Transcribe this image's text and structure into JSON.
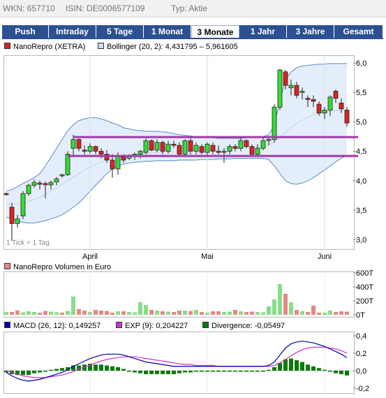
{
  "header": {
    "wkn": "WKN: 657710",
    "isin": "ISIN: DE0006577109",
    "typ": "Typ: Aktie"
  },
  "tabs": [
    {
      "label": "Push"
    },
    {
      "label": "Intraday"
    },
    {
      "label": "5 Tage"
    },
    {
      "label": "1 Monat"
    },
    {
      "label": "3 Monate",
      "active": true
    },
    {
      "label": "1 Jahr"
    },
    {
      "label": "3 Jahre"
    },
    {
      "label": "Gesamt"
    }
  ],
  "colors": {
    "up": "#33dd33",
    "down": "#dd2222",
    "band": "#e4eefa",
    "bandLine": "#5a89c8",
    "purple": "#a03aa8",
    "tab": "#2b5193",
    "macd": "#0000aa",
    "exp": "#cc33cc",
    "div": "#0a7a0a",
    "volDown": "#e48888",
    "volUp": "#88dd88"
  },
  "legends": {
    "price": "NanoRepro (XETRA)",
    "bollinger": "Bollinger (20, 2): 4,431795 – 5,961605",
    "volume": "NanoRepro Volumen in Euro",
    "macd": "MACD (26, 12): 0,149257",
    "exp": "EXP (9): 0,204227",
    "divergence": "Divergence: -0,05497"
  },
  "note": "1 Tick = 1 Tag",
  "chart_data": [
    {
      "type": "candlestick",
      "title": "NanoRepro (XETRA)",
      "x_labels": [
        "April",
        "Mai",
        "Juni"
      ],
      "x_label_index": [
        15,
        36,
        57
      ],
      "yticks": [
        3.0,
        3.5,
        4.0,
        4.5,
        5.0,
        5.5,
        6.0
      ],
      "ytick_labels": [
        "3,0",
        "3,5",
        "4,0",
        "4,5",
        "5,0",
        "5,5",
        "6,0"
      ],
      "ylim": [
        2.85,
        6.12
      ],
      "ohlc": [
        [
          3.78,
          3.8,
          3.75,
          3.77
        ],
        [
          3.55,
          3.62,
          2.98,
          3.27
        ],
        [
          3.27,
          3.42,
          3.2,
          3.35
        ],
        [
          3.4,
          3.82,
          3.35,
          3.78
        ],
        [
          3.78,
          3.95,
          3.74,
          3.92
        ],
        [
          3.92,
          4.02,
          3.88,
          3.97
        ],
        [
          3.96,
          4.0,
          3.85,
          3.94
        ],
        [
          3.95,
          3.99,
          3.7,
          3.93
        ],
        [
          3.93,
          4.0,
          3.85,
          3.97
        ],
        [
          3.98,
          4.06,
          3.92,
          4.03
        ],
        [
          4.1,
          4.12,
          4.05,
          4.1
        ],
        [
          4.1,
          4.5,
          4.08,
          4.45
        ],
        [
          4.55,
          4.78,
          4.4,
          4.7
        ],
        [
          4.7,
          4.72,
          4.5,
          4.55
        ],
        [
          4.52,
          4.6,
          4.45,
          4.5
        ],
        [
          4.5,
          4.63,
          4.46,
          4.58
        ],
        [
          4.58,
          4.6,
          4.45,
          4.5
        ],
        [
          4.5,
          4.55,
          4.38,
          4.45
        ],
        [
          4.45,
          4.52,
          4.3,
          4.35
        ],
        [
          4.35,
          4.45,
          4.05,
          4.2
        ],
        [
          4.2,
          4.48,
          4.1,
          4.42
        ],
        [
          4.4,
          4.45,
          4.3,
          4.35
        ],
        [
          4.38,
          4.45,
          4.35,
          4.42
        ],
        [
          4.42,
          4.48,
          4.35,
          4.45
        ],
        [
          4.45,
          4.52,
          4.38,
          4.5
        ],
        [
          4.48,
          4.72,
          4.45,
          4.68
        ],
        [
          4.68,
          4.7,
          4.5,
          4.52
        ],
        [
          4.52,
          4.7,
          4.48,
          4.65
        ],
        [
          4.65,
          4.68,
          4.45,
          4.5
        ],
        [
          4.5,
          4.68,
          4.46,
          4.62
        ],
        [
          4.62,
          4.68,
          4.55,
          4.6
        ],
        [
          4.6,
          4.65,
          4.4,
          4.45
        ],
        [
          4.45,
          4.7,
          4.4,
          4.68
        ],
        [
          4.68,
          4.72,
          4.45,
          4.5
        ],
        [
          4.5,
          4.65,
          4.45,
          4.6
        ],
        [
          4.58,
          4.62,
          4.45,
          4.48
        ],
        [
          4.48,
          4.65,
          4.4,
          4.62
        ],
        [
          4.6,
          4.65,
          4.45,
          4.5
        ],
        [
          4.5,
          4.6,
          4.45,
          4.48
        ],
        [
          4.48,
          4.55,
          4.3,
          4.5
        ],
        [
          4.5,
          4.62,
          4.45,
          4.58
        ],
        [
          4.58,
          4.62,
          4.5,
          4.55
        ],
        [
          4.55,
          4.72,
          4.5,
          4.68
        ],
        [
          4.68,
          4.7,
          4.55,
          4.58
        ],
        [
          4.58,
          4.62,
          4.4,
          4.45
        ],
        [
          4.45,
          4.62,
          4.4,
          4.55
        ],
        [
          4.55,
          4.75,
          4.52,
          4.68
        ],
        [
          4.7,
          4.75,
          4.6,
          4.7
        ],
        [
          4.7,
          5.3,
          4.65,
          5.25
        ],
        [
          5.25,
          5.9,
          5.2,
          5.88
        ],
        [
          5.85,
          5.88,
          5.55,
          5.62
        ],
        [
          5.58,
          5.72,
          5.45,
          5.62
        ],
        [
          5.62,
          5.68,
          5.4,
          5.45
        ],
        [
          5.5,
          5.58,
          5.38,
          5.52
        ],
        [
          5.4,
          5.45,
          5.25,
          5.38
        ],
        [
          5.38,
          5.45,
          5.25,
          5.35
        ],
        [
          5.3,
          5.35,
          5.1,
          5.15
        ],
        [
          5.15,
          5.25,
          5.05,
          5.2
        ],
        [
          5.2,
          5.45,
          5.1,
          5.42
        ],
        [
          5.52,
          5.55,
          5.32,
          5.4
        ],
        [
          5.32,
          5.4,
          5.15,
          5.22
        ],
        [
          5.2,
          5.25,
          4.92,
          4.98
        ]
      ],
      "bollinger": {
        "upper": [
          3.82,
          3.85,
          3.9,
          3.95,
          4.0,
          4.05,
          4.12,
          4.25,
          4.4,
          4.55,
          4.7,
          4.85,
          4.95,
          5.02,
          5.05,
          5.07,
          5.07,
          5.05,
          5.02,
          4.98,
          4.95,
          4.9,
          4.88,
          4.86,
          4.85,
          4.84,
          4.84,
          4.84,
          4.83,
          4.82,
          4.8,
          4.78,
          4.77,
          4.76,
          4.75,
          4.74,
          4.74,
          4.73,
          4.72,
          4.72,
          4.72,
          4.72,
          4.72,
          4.73,
          4.73,
          4.74,
          4.75,
          4.78,
          4.95,
          5.35,
          5.72,
          5.85,
          5.92,
          5.95,
          5.96,
          5.97,
          5.98,
          5.98,
          5.99,
          5.99,
          5.99,
          5.99
        ],
        "middle": [
          3.6,
          3.6,
          3.61,
          3.62,
          3.65,
          3.68,
          3.72,
          3.77,
          3.82,
          3.88,
          3.94,
          4.0,
          4.06,
          4.12,
          4.18,
          4.23,
          4.28,
          4.32,
          4.35,
          4.38,
          4.4,
          4.42,
          4.43,
          4.44,
          4.45,
          4.46,
          4.47,
          4.48,
          4.48,
          4.49,
          4.49,
          4.5,
          4.5,
          4.5,
          4.51,
          4.51,
          4.52,
          4.52,
          4.53,
          4.53,
          4.54,
          4.54,
          4.55,
          4.55,
          4.56,
          4.57,
          4.58,
          4.6,
          4.66,
          4.74,
          4.82,
          4.9,
          4.97,
          5.03,
          5.08,
          5.12,
          5.15,
          5.17,
          5.18,
          5.19,
          5.19,
          5.2
        ],
        "lower": [
          3.38,
          3.35,
          3.32,
          3.29,
          3.28,
          3.28,
          3.3,
          3.32,
          3.35,
          3.38,
          3.42,
          3.48,
          3.55,
          3.62,
          3.72,
          3.82,
          3.92,
          4.02,
          4.12,
          4.2,
          4.25,
          4.28,
          4.3,
          4.31,
          4.32,
          4.33,
          4.33,
          4.34,
          4.34,
          4.34,
          4.34,
          4.35,
          4.35,
          4.35,
          4.35,
          4.36,
          4.36,
          4.36,
          4.37,
          4.37,
          4.37,
          4.38,
          4.38,
          4.38,
          4.38,
          4.38,
          4.38,
          4.36,
          4.25,
          4.12,
          4.0,
          3.95,
          3.94,
          3.96,
          4.0,
          4.05,
          4.12,
          4.18,
          4.25,
          4.32,
          4.38,
          4.43
        ]
      },
      "hlines": [
        {
          "y": 4.74,
          "from": 12,
          "to": 62
        },
        {
          "y": 4.42,
          "from": 11,
          "to": 62
        }
      ]
    },
    {
      "type": "bar",
      "title": "NanoRepro Volumen in Euro",
      "ytick_labels": [
        "0T",
        "200T",
        "400T",
        "600T"
      ],
      "yticks": [
        0,
        200,
        400,
        600
      ],
      "ylim": [
        0,
        600
      ],
      "values": [
        40,
        40,
        60,
        35,
        50,
        40,
        30,
        55,
        45,
        35,
        30,
        55,
        260,
        80,
        60,
        40,
        70,
        60,
        55,
        30,
        50,
        50,
        40,
        35,
        180,
        140,
        70,
        60,
        50,
        45,
        40,
        60,
        60,
        55,
        70,
        40,
        30,
        50,
        50,
        40,
        45,
        70,
        50,
        40,
        45,
        40,
        35,
        120,
        220,
        440,
        300,
        180,
        70,
        50,
        40,
        130,
        30,
        30,
        60,
        40,
        50,
        45
      ],
      "up": [
        true,
        false,
        false,
        true,
        true,
        true,
        false,
        false,
        true,
        true,
        false,
        true,
        true,
        false,
        false,
        true,
        false,
        false,
        false,
        false,
        true,
        false,
        true,
        true,
        true,
        true,
        false,
        true,
        false,
        true,
        false,
        false,
        true,
        false,
        true,
        false,
        true,
        false,
        false,
        true,
        true,
        false,
        true,
        false,
        false,
        true,
        true,
        true,
        true,
        true,
        false,
        true,
        false,
        true,
        false,
        false,
        false,
        true,
        true,
        false,
        false,
        false
      ]
    },
    {
      "type": "line",
      "title": "MACD",
      "ytick_labels": [
        "0,4",
        "0,2",
        "0,0",
        "-0,2"
      ],
      "yticks": [
        0.4,
        0.2,
        0.0,
        -0.2
      ],
      "ylim": [
        -0.25,
        0.45
      ],
      "series": [
        {
          "name": "MACD (26, 12): 0,149257",
          "values": [
            -0.02,
            -0.06,
            -0.09,
            -0.11,
            -0.12,
            -0.11,
            -0.1,
            -0.08,
            -0.06,
            -0.04,
            -0.02,
            0.01,
            0.05,
            0.08,
            0.11,
            0.14,
            0.16,
            0.18,
            0.19,
            0.19,
            0.19,
            0.18,
            0.16,
            0.14,
            0.12,
            0.1,
            0.09,
            0.08,
            0.07,
            0.06,
            0.05,
            0.05,
            0.05,
            0.05,
            0.05,
            0.05,
            0.05,
            0.05,
            0.05,
            0.05,
            0.05,
            0.05,
            0.05,
            0.05,
            0.05,
            0.05,
            0.05,
            0.06,
            0.1,
            0.18,
            0.26,
            0.31,
            0.33,
            0.34,
            0.33,
            0.32,
            0.3,
            0.28,
            0.25,
            0.22,
            0.19,
            0.15
          ]
        },
        {
          "name": "EXP (9): 0,204227",
          "values": [
            0.0,
            -0.02,
            -0.04,
            -0.06,
            -0.07,
            -0.08,
            -0.08,
            -0.08,
            -0.07,
            -0.06,
            -0.05,
            -0.03,
            -0.01,
            0.02,
            0.04,
            0.06,
            0.09,
            0.11,
            0.13,
            0.14,
            0.15,
            0.16,
            0.16,
            0.16,
            0.15,
            0.14,
            0.13,
            0.12,
            0.11,
            0.1,
            0.09,
            0.08,
            0.07,
            0.07,
            0.06,
            0.06,
            0.06,
            0.06,
            0.05,
            0.05,
            0.05,
            0.05,
            0.05,
            0.05,
            0.05,
            0.05,
            0.05,
            0.05,
            0.06,
            0.09,
            0.13,
            0.17,
            0.21,
            0.24,
            0.26,
            0.27,
            0.27,
            0.27,
            0.26,
            0.25,
            0.23,
            0.2
          ]
        },
        {
          "name": "Divergence: -0,05497",
          "values": [
            -0.02,
            -0.04,
            -0.05,
            -0.05,
            -0.05,
            -0.03,
            -0.02,
            0.0,
            0.01,
            0.02,
            0.03,
            0.04,
            0.06,
            0.06,
            0.07,
            0.08,
            0.07,
            0.07,
            0.06,
            0.05,
            0.04,
            0.02,
            0.0,
            -0.02,
            -0.03,
            -0.04,
            -0.04,
            -0.04,
            -0.04,
            -0.04,
            -0.04,
            -0.03,
            -0.02,
            -0.02,
            -0.01,
            -0.01,
            -0.01,
            -0.01,
            0.0,
            0.0,
            0.0,
            0.0,
            0.0,
            0.0,
            0.0,
            0.0,
            0.0,
            0.01,
            0.04,
            0.09,
            0.13,
            0.14,
            0.12,
            0.1,
            0.07,
            0.05,
            0.03,
            0.01,
            -0.01,
            -0.03,
            -0.04,
            -0.055
          ]
        }
      ]
    }
  ]
}
